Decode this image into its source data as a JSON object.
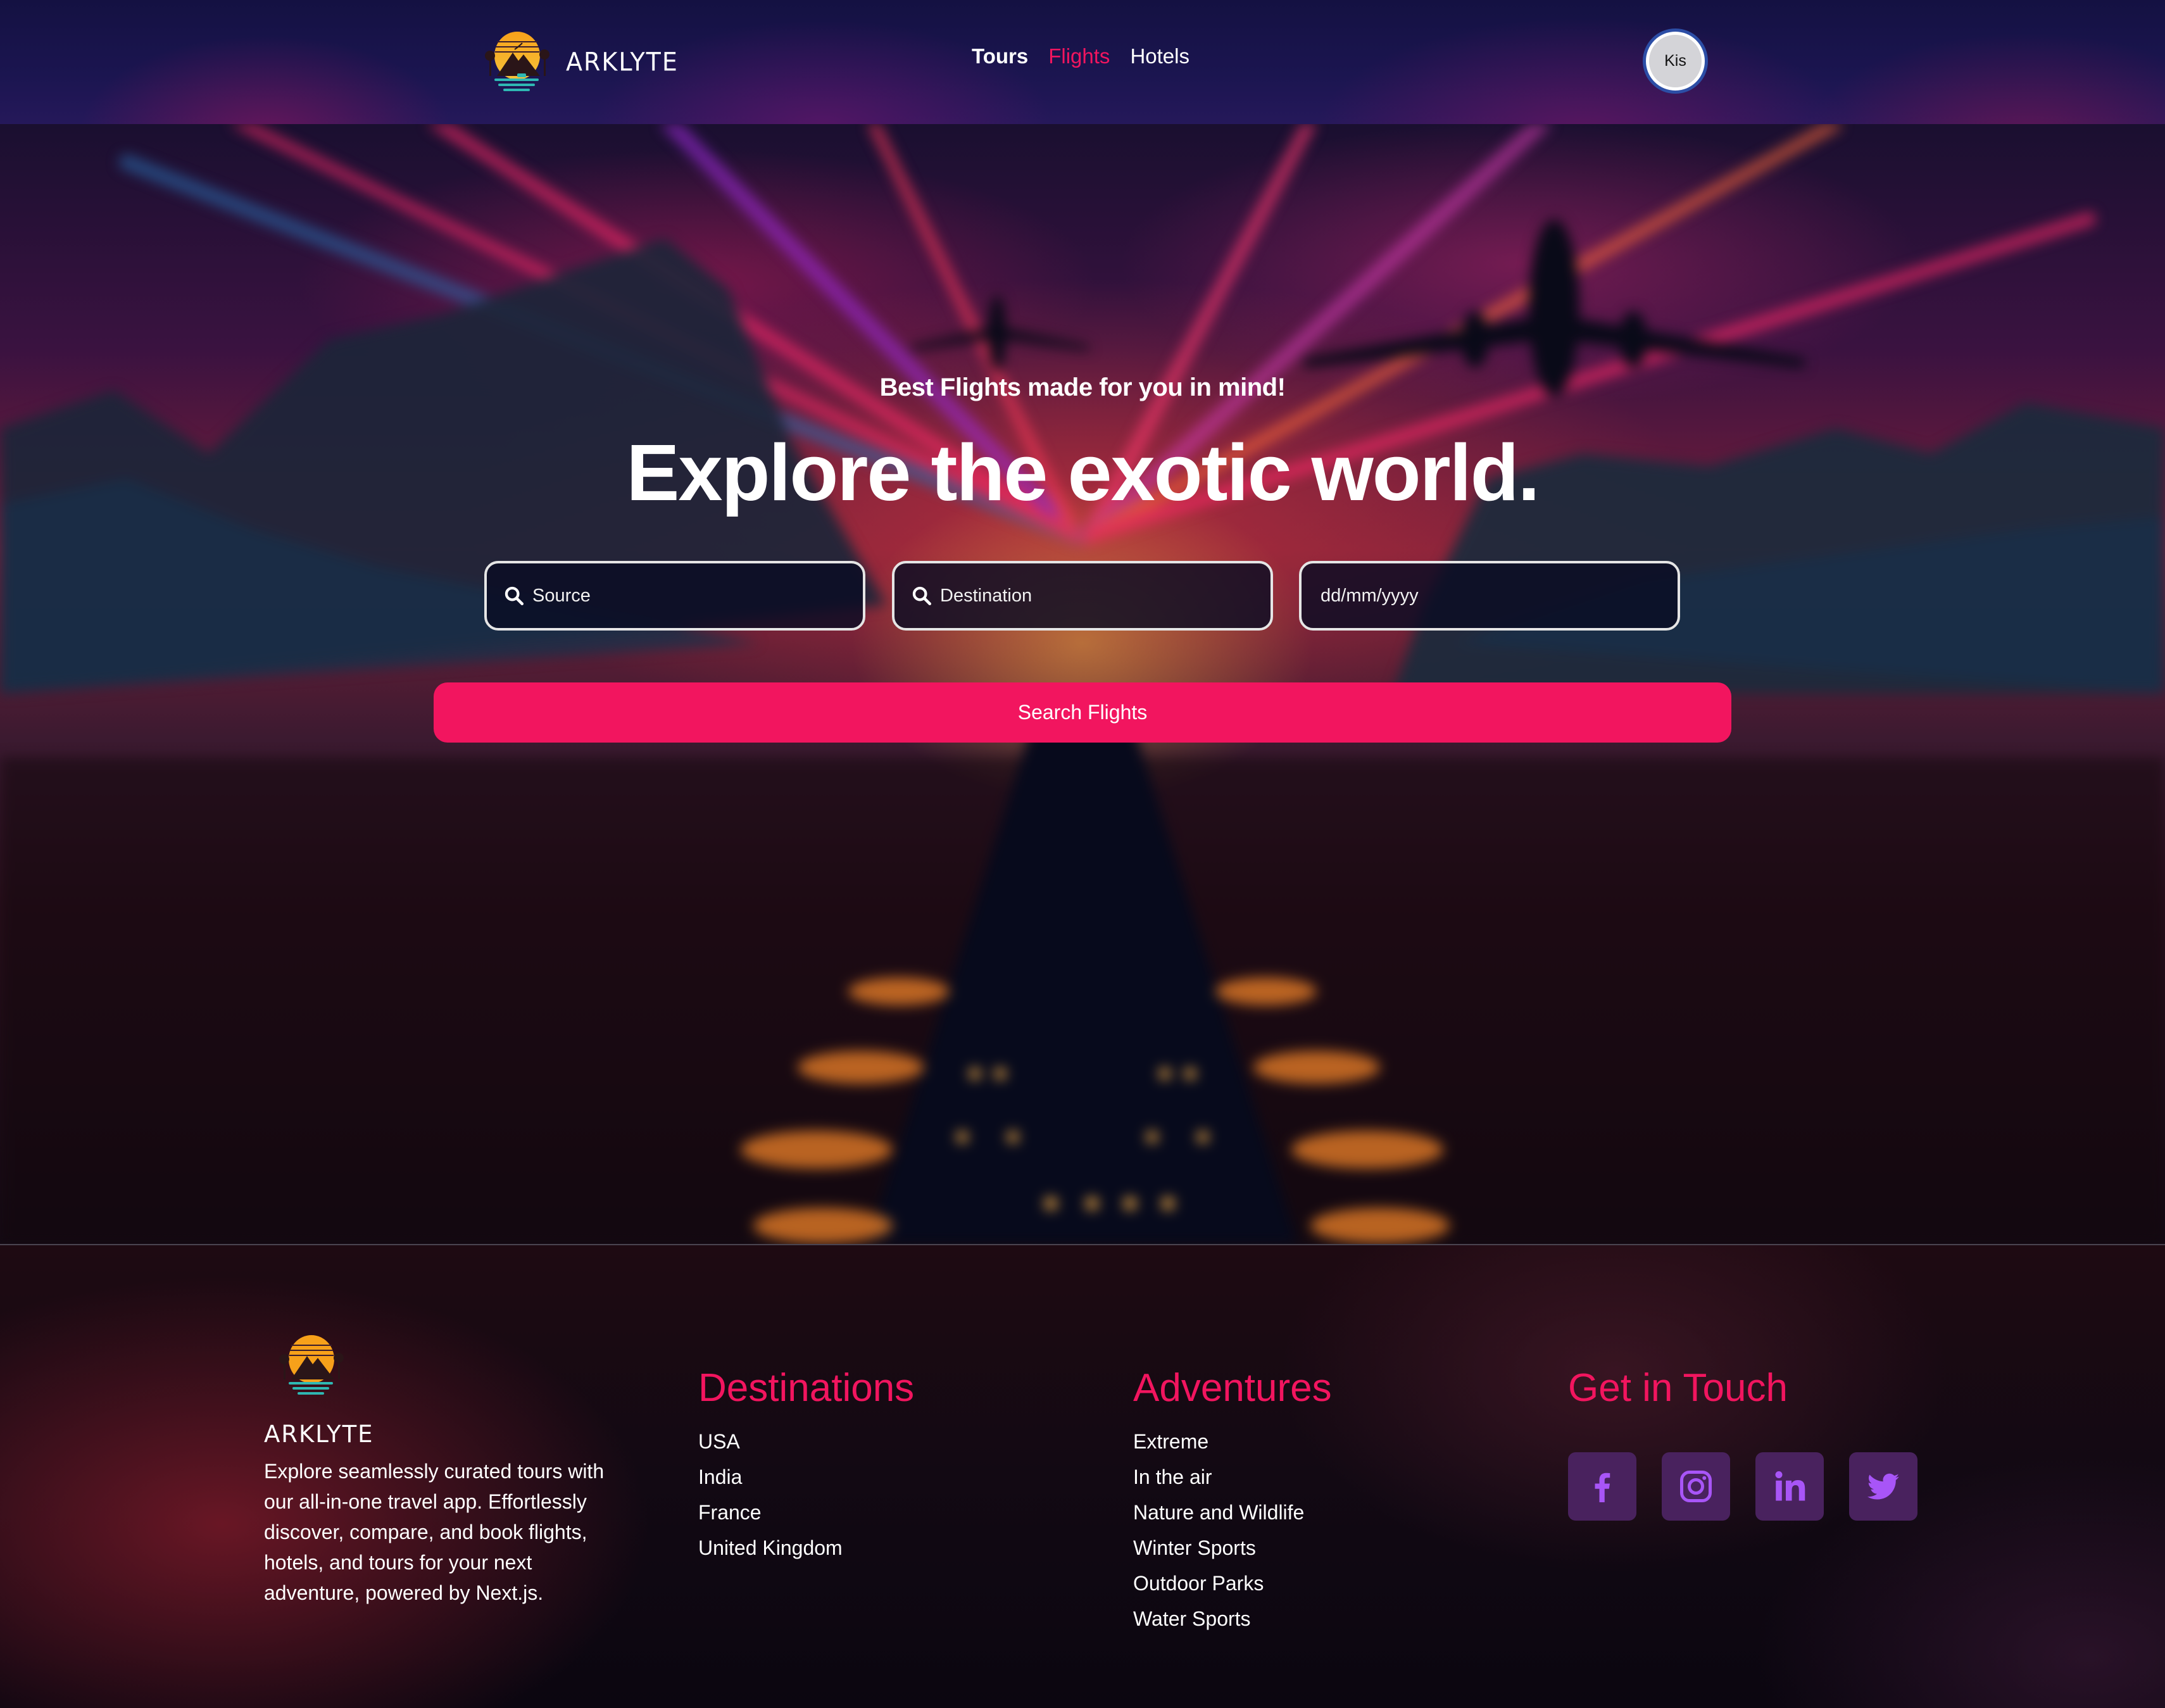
{
  "header": {
    "brand_name": "ARKLYTE",
    "logo_icon": "sunset-mountain-logo",
    "nav": [
      {
        "label": "Tours",
        "active": false
      },
      {
        "label": "Flights",
        "active": true
      },
      {
        "label": "Hotels",
        "active": false
      }
    ],
    "avatar_text": "Kis"
  },
  "hero": {
    "subtitle": "Best Flights made for you in mind!",
    "title": "Explore the exotic world.",
    "source_placeholder": "Source",
    "destination_placeholder": "Destination",
    "date_placeholder": "dd/mm/yyyy",
    "search_icon": "search-icon",
    "search_button": "Search Flights"
  },
  "footer": {
    "brand_name": "ARKLYTE",
    "description": "Explore seamlessly curated tours with our all-in-one travel app. Effortlessly discover, compare, and book flights, hotels, and tours for your next adventure, powered by Next.js.",
    "destinations": {
      "heading": "Destinations",
      "items": [
        "USA",
        "India",
        "France",
        "United Kingdom"
      ]
    },
    "adventures": {
      "heading": "Adventures",
      "items": [
        "Extreme",
        "In the air",
        "Nature and Wildlife",
        "Winter Sports",
        "Outdoor Parks",
        "Water Sports"
      ]
    },
    "contact": {
      "heading": "Get in Touch",
      "socials": [
        "facebook-icon",
        "instagram-icon",
        "linkedin-icon",
        "twitter-icon"
      ]
    }
  },
  "colors": {
    "accent": "#F2155F",
    "social_bg": "#49225E",
    "social_icon": "#A855F7",
    "avatar_ring": "#2C4EA6"
  }
}
